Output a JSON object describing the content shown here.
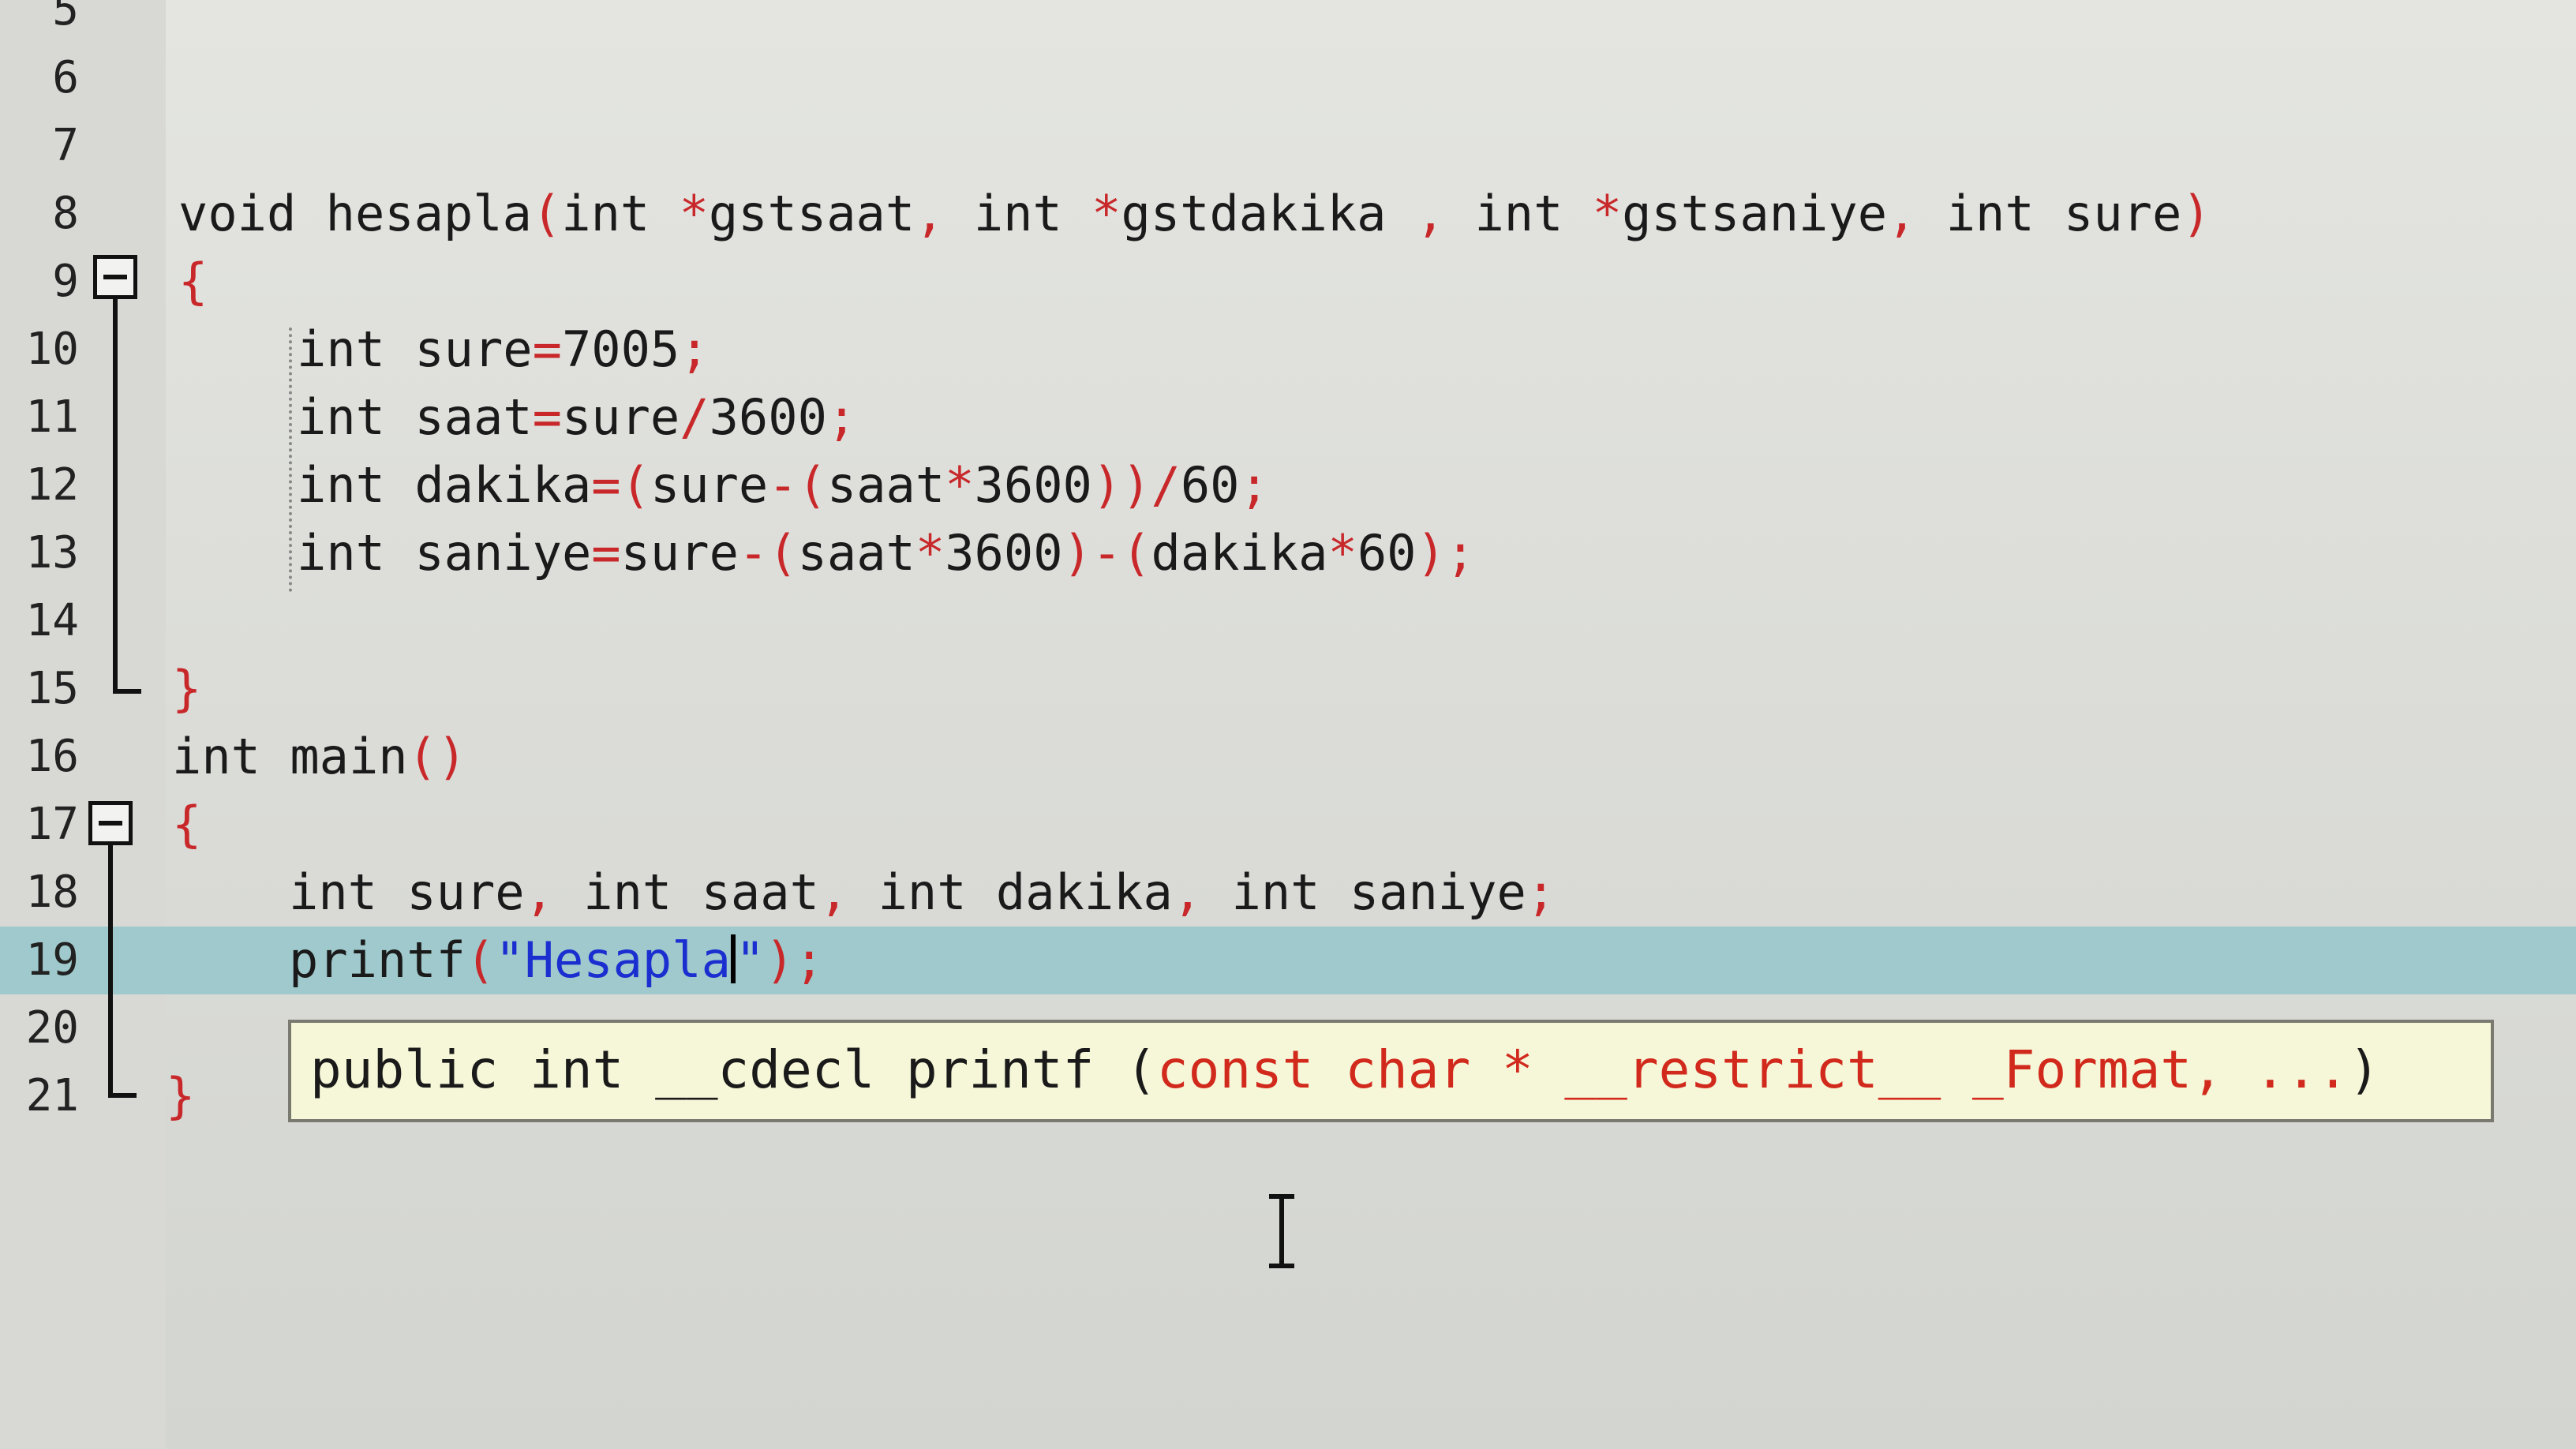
{
  "editor": {
    "lines": [
      {
        "number": "5"
      },
      {
        "number": "6"
      },
      {
        "number": "7"
      },
      {
        "number": "8",
        "tokens": [
          {
            "t": "void ",
            "c": "kw"
          },
          {
            "t": "hesapla",
            "c": "kw"
          },
          {
            "t": "(",
            "c": "op"
          },
          {
            "t": "int ",
            "c": "kw"
          },
          {
            "t": "*",
            "c": "op"
          },
          {
            "t": "gstsaat",
            "c": "kw"
          },
          {
            "t": ", ",
            "c": "op"
          },
          {
            "t": "int ",
            "c": "kw"
          },
          {
            "t": "*",
            "c": "op"
          },
          {
            "t": "gstdakika ",
            "c": "kw"
          },
          {
            "t": ", ",
            "c": "op"
          },
          {
            "t": "int ",
            "c": "kw"
          },
          {
            "t": "*",
            "c": "op"
          },
          {
            "t": "gstsaniye",
            "c": "kw"
          },
          {
            "t": ", ",
            "c": "op"
          },
          {
            "t": "int ",
            "c": "kw"
          },
          {
            "t": "sure",
            "c": "kw"
          },
          {
            "t": ")",
            "c": "op"
          }
        ]
      },
      {
        "number": "9",
        "tokens": [
          {
            "t": "{",
            "c": "op"
          }
        ]
      },
      {
        "number": "10",
        "tokens": [
          {
            "t": "int ",
            "c": "kw"
          },
          {
            "t": "sure",
            "c": "kw"
          },
          {
            "t": "=",
            "c": "op"
          },
          {
            "t": "7005",
            "c": "num"
          },
          {
            "t": ";",
            "c": "op"
          }
        ]
      },
      {
        "number": "11",
        "tokens": [
          {
            "t": "int ",
            "c": "kw"
          },
          {
            "t": "saat",
            "c": "kw"
          },
          {
            "t": "=",
            "c": "op"
          },
          {
            "t": "sure",
            "c": "kw"
          },
          {
            "t": "/",
            "c": "op"
          },
          {
            "t": "3600",
            "c": "num"
          },
          {
            "t": ";",
            "c": "op"
          }
        ]
      },
      {
        "number": "12",
        "tokens": [
          {
            "t": "int ",
            "c": "kw"
          },
          {
            "t": "dakika",
            "c": "kw"
          },
          {
            "t": "=(",
            "c": "op"
          },
          {
            "t": "sure",
            "c": "kw"
          },
          {
            "t": "-(",
            "c": "op"
          },
          {
            "t": "saat",
            "c": "kw"
          },
          {
            "t": "*",
            "c": "op"
          },
          {
            "t": "3600",
            "c": "num"
          },
          {
            "t": "))/",
            "c": "op"
          },
          {
            "t": "60",
            "c": "num"
          },
          {
            "t": ";",
            "c": "op"
          }
        ]
      },
      {
        "number": "13",
        "tokens": [
          {
            "t": "int ",
            "c": "kw"
          },
          {
            "t": "saniye",
            "c": "kw"
          },
          {
            "t": "=",
            "c": "op"
          },
          {
            "t": "sure",
            "c": "kw"
          },
          {
            "t": "-(",
            "c": "op"
          },
          {
            "t": "saat",
            "c": "kw"
          },
          {
            "t": "*",
            "c": "op"
          },
          {
            "t": "3600",
            "c": "num"
          },
          {
            "t": ")-(",
            "c": "op"
          },
          {
            "t": "dakika",
            "c": "kw"
          },
          {
            "t": "*",
            "c": "op"
          },
          {
            "t": "60",
            "c": "num"
          },
          {
            "t": ");",
            "c": "op"
          }
        ]
      },
      {
        "number": "14"
      },
      {
        "number": "15",
        "tokens": [
          {
            "t": "}",
            "c": "op"
          }
        ]
      },
      {
        "number": "16",
        "tokens": [
          {
            "t": "int ",
            "c": "kw"
          },
          {
            "t": "main",
            "c": "kw"
          },
          {
            "t": "()",
            "c": "op"
          }
        ]
      },
      {
        "number": "17",
        "tokens": [
          {
            "t": "{",
            "c": "op"
          }
        ]
      },
      {
        "number": "18",
        "tokens": [
          {
            "t": "int ",
            "c": "kw"
          },
          {
            "t": "sure",
            "c": "kw"
          },
          {
            "t": ", ",
            "c": "op"
          },
          {
            "t": "int ",
            "c": "kw"
          },
          {
            "t": "saat",
            "c": "kw"
          },
          {
            "t": ", ",
            "c": "op"
          },
          {
            "t": "int ",
            "c": "kw"
          },
          {
            "t": "dakika",
            "c": "kw"
          },
          {
            "t": ", ",
            "c": "op"
          },
          {
            "t": "int ",
            "c": "kw"
          },
          {
            "t": "saniye",
            "c": "kw"
          },
          {
            "t": ";",
            "c": "op"
          }
        ]
      },
      {
        "number": "19",
        "tokens": [
          {
            "t": "printf",
            "c": "kw"
          },
          {
            "t": "(",
            "c": "op"
          },
          {
            "t": "\"Hesapla",
            "c": "str"
          },
          {
            "t": "CARET",
            "c": "caret"
          },
          {
            "t": "\"",
            "c": "str"
          },
          {
            "t": ");",
            "c": "op"
          }
        ]
      },
      {
        "number": "20"
      },
      {
        "number": "21",
        "tokens": [
          {
            "t": "}",
            "c": "op"
          }
        ]
      }
    ]
  },
  "tooltip": {
    "signature_prefix": "public int __cdecl printf (",
    "signature_params": "const char * __restrict__ _Format, ...",
    "signature_suffix": ")"
  },
  "colors": {
    "operator": "#c8282a",
    "string": "#1b2fd0",
    "current_line": "#9fc9cc",
    "tooltip_bg": "#f6f6d8"
  }
}
